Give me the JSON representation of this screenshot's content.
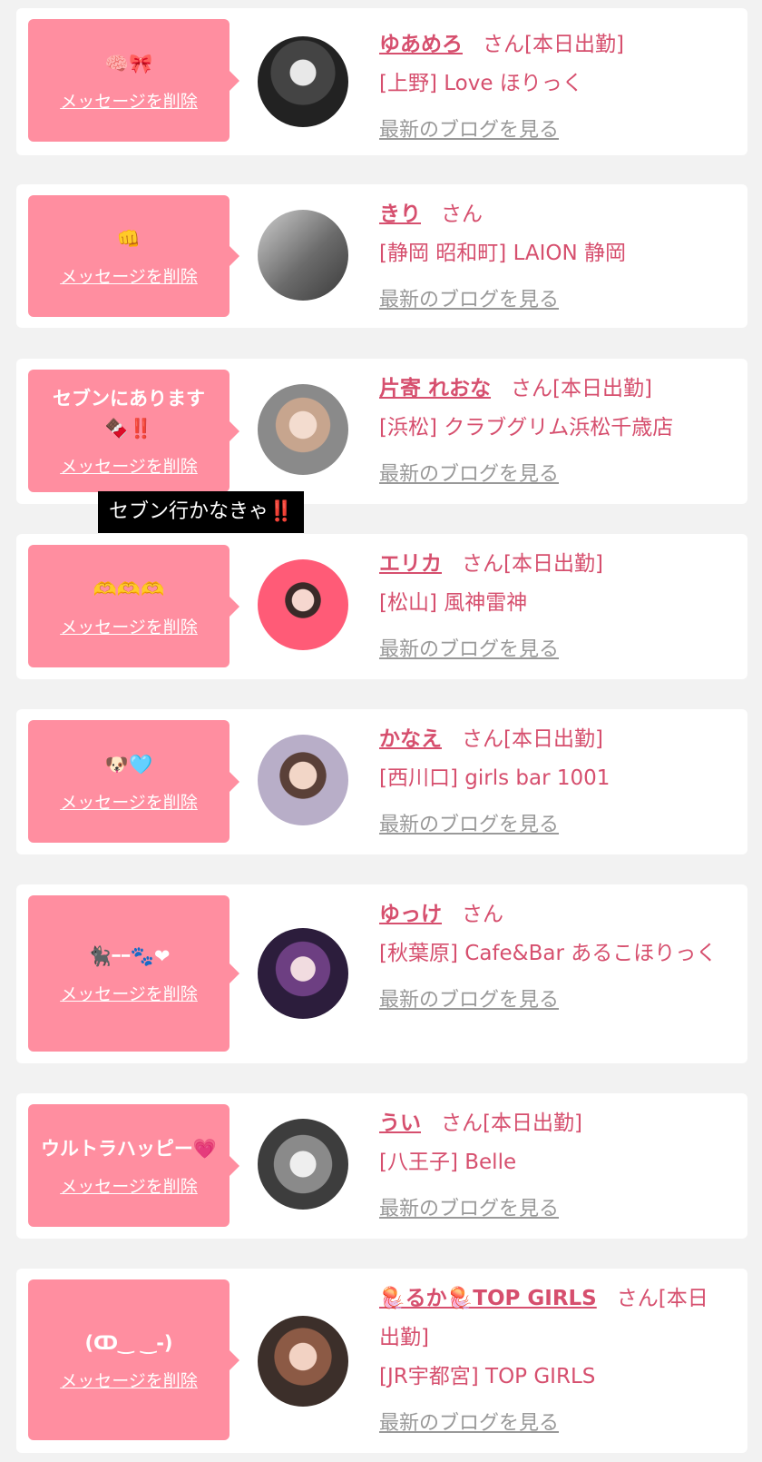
{
  "delete_label": "メッセージを削除",
  "blog_label": "最新のブログを見る",
  "suffix_san": "さん",
  "suffix_working": "さん[本日出勤]",
  "tooltip": "セブン行かなきゃ‼️",
  "colors": {
    "accent": "#d64f6e",
    "bubble": "#ff8ea0",
    "link_gray": "#999999"
  },
  "cards": [
    {
      "message": "🧠🎀",
      "name": "ゆあめろ",
      "working": true,
      "shop": "[上野] Love ほりっく"
    },
    {
      "message": "👊",
      "name": "きり",
      "working": false,
      "shop": "[静岡 昭和町] LAION 静岡"
    },
    {
      "message": "セブンにあります🍫‼️",
      "name": "片寄 れおな",
      "working": true,
      "shop": "[浜松] クラブグリム浜松千歳店"
    },
    {
      "message": "🫶🫶🫶",
      "name": "エリカ",
      "working": true,
      "shop": "[松山] 風神雷神"
    },
    {
      "message": "🐶🩵",
      "name": "かなえ",
      "working": true,
      "shop": "[西川口] girls bar 1001"
    },
    {
      "message": "🐈‍⬛ｰｰ🐾❤",
      "name": "ゆっけ",
      "working": false,
      "shop": "[秋葉原] Cafe&Bar あるこほりっく"
    },
    {
      "message": "ウルトラハッピー💗",
      "name": "うい",
      "working": true,
      "shop": "[八王子] Belle"
    },
    {
      "message": "(ↀ‿ ‿-)",
      "name": "🪼るか🪼TOP GIRLS",
      "working": true,
      "shop": "[JR宇都宮] TOP GIRLS"
    }
  ]
}
